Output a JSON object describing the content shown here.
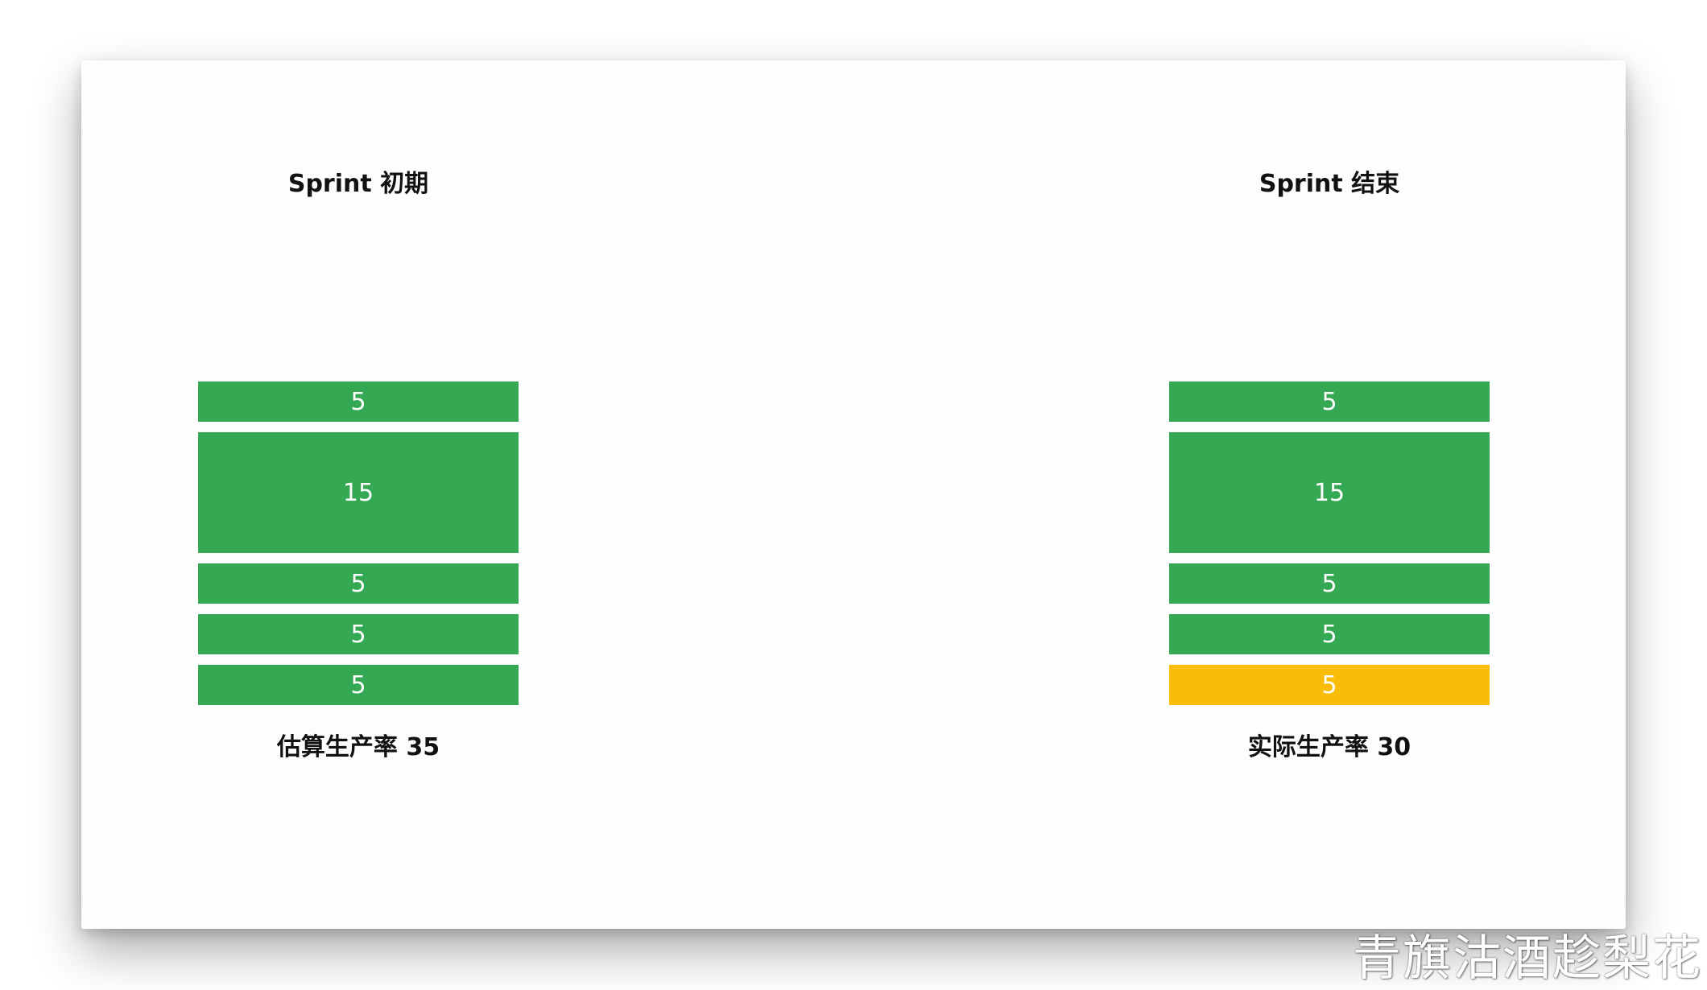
{
  "colors": {
    "done": "#34a853",
    "incomplete": "#f9bc09"
  },
  "left": {
    "title": "Sprint 初期",
    "caption": "估算生产率 35",
    "blocks": [
      {
        "value": "5",
        "points": 5,
        "status": "done"
      },
      {
        "value": "15",
        "points": 15,
        "status": "done"
      },
      {
        "value": "5",
        "points": 5,
        "status": "done"
      },
      {
        "value": "5",
        "points": 5,
        "status": "done"
      },
      {
        "value": "5",
        "points": 5,
        "status": "done"
      }
    ]
  },
  "right": {
    "title": "Sprint 结束",
    "caption": "实际生产率 30",
    "blocks": [
      {
        "value": "5",
        "points": 5,
        "status": "done"
      },
      {
        "value": "15",
        "points": 15,
        "status": "done"
      },
      {
        "value": "5",
        "points": 5,
        "status": "done"
      },
      {
        "value": "5",
        "points": 5,
        "status": "done"
      },
      {
        "value": "5",
        "points": 5,
        "status": "incomplete"
      }
    ]
  },
  "watermark": "青旗沽酒趁梨花"
}
